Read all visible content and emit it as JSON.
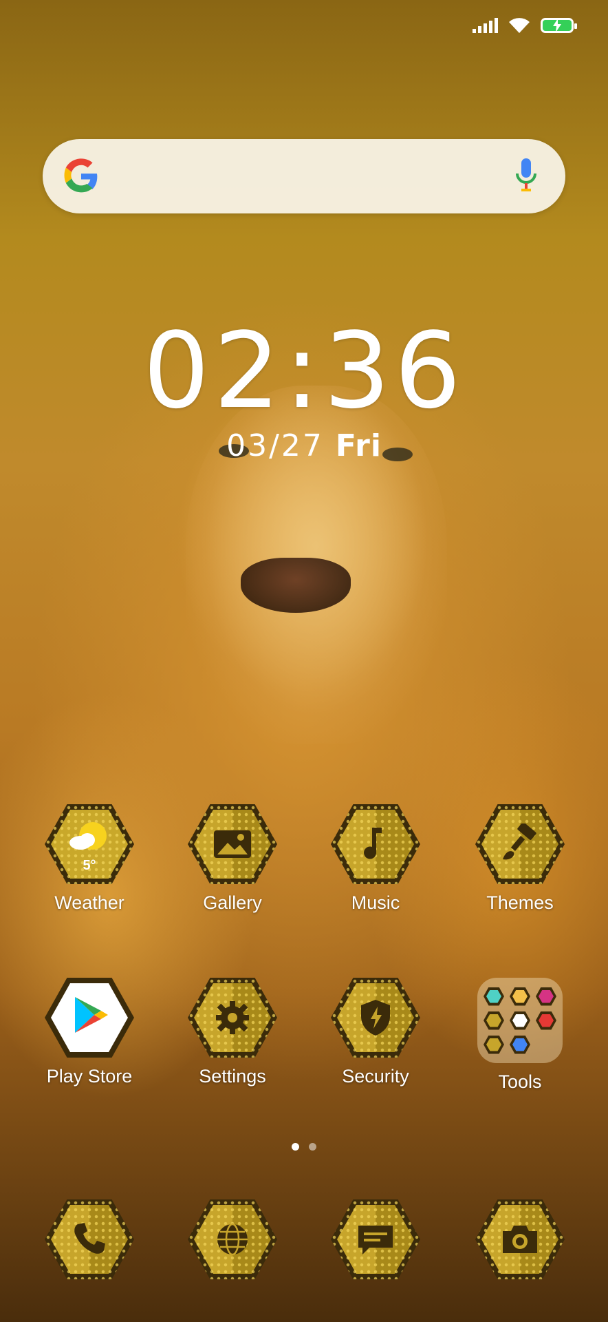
{
  "status_bar": {
    "icons": [
      "signal-icon",
      "wifi-icon",
      "battery-charging-icon"
    ],
    "battery_color": "#34d058"
  },
  "search": {
    "logo": "google-logo",
    "mic": "mic-icon"
  },
  "clock": {
    "hours": "02",
    "separator": ":",
    "minutes": "36",
    "date": "03/27",
    "weekday": "Fri"
  },
  "apps_row1": [
    {
      "label": "Weather",
      "icon": "weather-sun-cloud-icon",
      "temp": "5°"
    },
    {
      "label": "Gallery",
      "icon": "gallery-icon"
    },
    {
      "label": "Music",
      "icon": "music-note-icon"
    },
    {
      "label": "Themes",
      "icon": "paintbrush-icon"
    }
  ],
  "apps_row2": [
    {
      "label": "Play Store",
      "icon": "play-store-icon"
    },
    {
      "label": "Settings",
      "icon": "gear-icon"
    },
    {
      "label": "Security",
      "icon": "shield-bolt-icon"
    },
    {
      "label": "Tools",
      "icon": "folder-icon"
    }
  ],
  "page_indicator": {
    "count": 2,
    "active": 1
  },
  "dock": [
    {
      "icon": "phone-icon"
    },
    {
      "icon": "browser-globe-icon"
    },
    {
      "icon": "messages-icon"
    },
    {
      "icon": "camera-icon"
    }
  ],
  "colors": {
    "hex_gold_light": "#c7a52b",
    "hex_gold_dark": "#a88919",
    "hex_border": "#3b2b0a"
  }
}
